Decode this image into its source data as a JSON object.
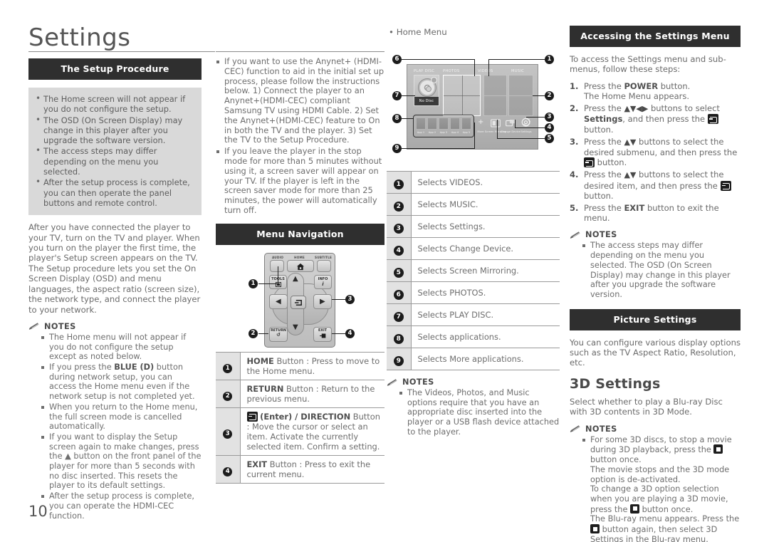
{
  "page": {
    "title": "Settings",
    "number": "10"
  },
  "col1": {
    "section_title": "The Setup Procedure",
    "callout_bullets": [
      "The Home screen will not appear if you do not configure the setup.",
      "The OSD (On Screen Display) may change in this player after you upgrade the software version.",
      "The access steps may differ depending on the menu you selected.",
      "After the setup process is complete, you can then operate the panel buttons and remote control."
    ],
    "paragraph": "After you have connected the player to your TV, turn on the TV and player. When you turn on the player the first time, the player's Setup screen appears on the TV. The Setup procedure lets you set the On Screen Display (OSD) and menu languages, the aspect ratio (screen size), the network type, and connect the player to your network.",
    "notes_label": "NOTES",
    "notes": [
      "The Home menu will not appear if you do not configure the setup except as noted below.",
      "If you press the BLUE (D) button during network setup, you can access the Home menu even if the network setup is not completed yet.",
      "When you return to the Home menu, the full screen mode is cancelled automatically.",
      "If you want to display the Setup screen again to make changes, press the ▲ button on the front panel of the player for more than 5 seconds with no disc inserted. This resets the player to its default settings.",
      "After the setup process is complete, you can operate the HDMI-CEC function."
    ]
  },
  "col2": {
    "notes": [
      "If you want to use the Anynet+ (HDMI-CEC) function to aid in the initial set up process, please follow the instructions below. 1) Connect the player to an Anynet+(HDMI-CEC) compliant Samsung TV using HDMI Cable. 2) Set the Anynet+(HDMI-CEC) feature to On in both the TV and the player. 3) Set the TV to the Setup Procedure.",
      "If you leave the player in the stop mode for more than 5 minutes without using it, a screen saver will appear on your TV. If the player is left in the screen saver mode for more than 25 minutes, the power will automatically turn off."
    ],
    "section_title": "Menu Navigation",
    "remote": {
      "labels": {
        "audio": "AUDIO",
        "home": "HOME",
        "subtitle": "SUBTITLE"
      },
      "buttons": {
        "tools": "TOOLS",
        "info": "INFO",
        "return": "RETURN",
        "exit": "EXIT"
      },
      "callouts": [
        "1",
        "2",
        "3",
        "4"
      ]
    },
    "table": [
      {
        "key": "1",
        "bold": "HOME",
        "text": " Button : Press to move to the Home menu."
      },
      {
        "key": "2",
        "bold": "RETURN",
        "text": " Button : Return to the previous menu."
      },
      {
        "key": "3",
        "bold": "(Enter) / DIRECTION",
        "text": " Button : Move the cursor or select an item. Activate the currently selected item. Confirm a setting."
      },
      {
        "key": "4",
        "bold": "EXIT",
        "text": " Button : Press to exit the current menu."
      }
    ]
  },
  "col3": {
    "figure_label": "Home Menu",
    "home_menu": {
      "tile_headers": [
        "PLAY DISC",
        "PHOTOS",
        "VIDEOS",
        "MUSIC"
      ],
      "disc_status": "No Disc",
      "apps": [
        "App 1",
        "App 2",
        "App 3",
        "App 4",
        "App 5"
      ],
      "more_label": "More",
      "bottom_items": [
        "Screen Mirroring",
        "Change Device",
        "Settings"
      ],
      "callouts": [
        "1",
        "2",
        "3",
        "4",
        "5",
        "6",
        "7",
        "8",
        "9"
      ]
    },
    "table": [
      {
        "key": "1",
        "text": "Selects VIDEOS."
      },
      {
        "key": "2",
        "text": "Selects MUSIC."
      },
      {
        "key": "3",
        "text": "Selects Settings."
      },
      {
        "key": "4",
        "text": "Selects Change Device."
      },
      {
        "key": "5",
        "text": "Selects Screen Mirroring."
      },
      {
        "key": "6",
        "text": "Selects PHOTOS."
      },
      {
        "key": "7",
        "text": "Selects PLAY DISC."
      },
      {
        "key": "8",
        "text": "Selects applications."
      },
      {
        "key": "9",
        "text": "Selects More applications."
      }
    ],
    "notes_label": "NOTES",
    "notes": [
      "The Videos, Photos, and Music options require that you have an appropriate disc inserted into the player or a USB flash device attached to the player."
    ]
  },
  "col4": {
    "section_title": "Accessing the Settings Menu",
    "intro": "To access the Settings menu and sub-menus, follow these steps:",
    "steps": [
      {
        "num": "1.",
        "parts": [
          "Press the ",
          "POWER",
          " button.",
          "The Home Menu appears."
        ]
      },
      {
        "num": "2.",
        "parts": [
          "Press the ",
          "▲▼ ◄►",
          " buttons to select ",
          "Settings",
          ", and then press the ",
          "[enter]",
          " button."
        ]
      },
      {
        "num": "3.",
        "parts": [
          "Press the ",
          "▲▼",
          " buttons to select the desired submenu, and then press the ",
          "[enter]",
          " button."
        ]
      },
      {
        "num": "4.",
        "parts": [
          "Press the ",
          "▲▼",
          " buttons to select the desired item, and then press the ",
          "[enter]",
          " button."
        ]
      },
      {
        "num": "5.",
        "parts": [
          "Press the ",
          "EXIT",
          " button to exit the menu."
        ]
      }
    ],
    "notes_label": "NOTES",
    "notes": [
      "The access steps may differ depending on the menu you selected. The OSD (On Screen Display) may change in this player after you upgrade the software version."
    ],
    "picture_title": "Picture Settings",
    "picture_text": "You can configure various display options such as the TV Aspect Ratio, Resolution, etc.",
    "threed_title": "3D Settings",
    "threed_text": "Select whether to play a Blu-ray Disc with 3D contents in 3D Mode.",
    "threed_notes_label": "NOTES",
    "threed_note_parts": [
      "For some 3D discs, to stop a movie during 3D playback, press the ",
      " button once.",
      "The movie stops and the 3D mode option is de-activated.",
      "To change a 3D option selection when you are playing a 3D movie, press the ",
      " button once.",
      "The Blu-ray menu appears. Press the ",
      " button again, then select 3D Settings in the Blu-ray menu."
    ]
  },
  "colors": {
    "header_bg": "#2f2f2f",
    "callout_bg": "#d9d9d9",
    "table_key_bg": "#e2e2e2",
    "text": "#6b6b6b",
    "rule": "#8a8a8a"
  }
}
